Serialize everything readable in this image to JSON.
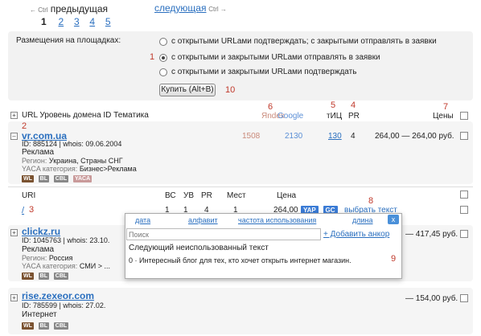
{
  "pager": {
    "prev_hint": "← Ctrl",
    "prev_label": "предыдущая",
    "next_label": "следующая",
    "next_hint": "Ctrl →",
    "current": "1",
    "pages": [
      "2",
      "3",
      "4",
      "5"
    ]
  },
  "placement": {
    "label": "Размещения на площадках:",
    "options": [
      "с открытыми URLами подтверждать; с закрытыми отправлять в заявки",
      "с открытыми и закрытыми URLами отправлять в заявки",
      "с открытыми и закрытыми URLами подтверждать"
    ],
    "selected_index": 1,
    "buy_button": "Купить (Alt+B)"
  },
  "markers": {
    "m1": "1",
    "m2": "2",
    "m3": "3",
    "m4": "4",
    "m5": "5",
    "m6": "6",
    "m7": "7",
    "m8": "8",
    "m9": "9",
    "m10": "10"
  },
  "header": {
    "cols_text": "URL Уровень домена ID Тематика",
    "yandex": "Яndex",
    "google": "Google",
    "tic": "тИЦ",
    "pr": "PR",
    "price": "Цены"
  },
  "sites": [
    {
      "url": "vr.com.ua",
      "id_line": "ID: 885124 | whois: 09.06.2004",
      "topic": "Реклама",
      "region_label": "Регион:",
      "region": "Украина, Страны СНГ",
      "yaca_label": "YACA категория:",
      "yaca": "Бизнес>Реклама",
      "yandex": "1508",
      "google": "2130",
      "tic": "130",
      "pr": "4",
      "price": "264,00 — 264,00 руб."
    },
    {
      "url": "clickz.ru",
      "id_line": "ID: 1045763 | whois: 23.10.",
      "topic": "Реклама",
      "region_label": "Регион:",
      "region": "Россия",
      "yaca_label": "YACA категория:",
      "yaca": "СМИ > ...",
      "price": "— 417,45 руб."
    },
    {
      "url": "rise.zexeor.com",
      "id_line": "ID: 785599 | whois: 27.02.",
      "topic": "Интернет",
      "price": "— 154,00 руб."
    }
  ],
  "tags": [
    "WL",
    "BL",
    "CBL",
    "YACA"
  ],
  "subtable": {
    "headers": [
      "URI",
      "ВС",
      "УВ",
      "PR",
      "Мест",
      "Цена"
    ],
    "row": {
      "uri": "/",
      "bc": "1",
      "uv": "1",
      "pr": "4",
      "mest": "1",
      "price": "264,00",
      "yap": "YAP",
      "gc": "GC",
      "choose": "выбрать текст"
    }
  },
  "popup": {
    "sorts": [
      "дата",
      "алфавит",
      "частота использования",
      "длина"
    ],
    "close": "x",
    "search_placeholder": "Поиск",
    "add_anchor": "+ Добавить анкор",
    "next_unused": "Следующий неиспользованный текст",
    "text_item": "0 · Интересный блог для тех, кто хочет открыть интернет магазин."
  },
  "colors": {
    "link": "#2a6fbf",
    "marker": "#c0392b",
    "wl": "#7a5230",
    "bl": "#888888",
    "cbl": "#888888",
    "yaca": "#c99a9a",
    "yap": "#3a7bd5"
  }
}
